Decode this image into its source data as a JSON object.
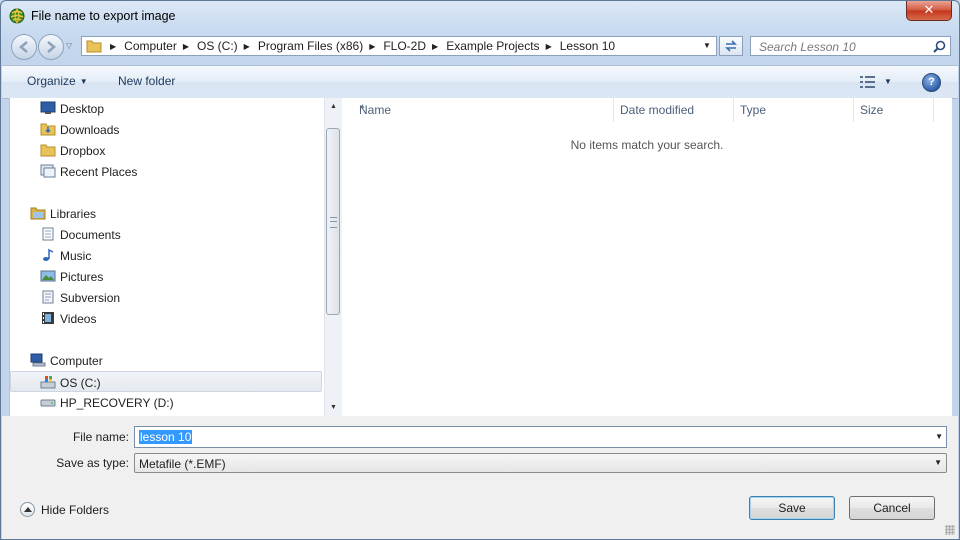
{
  "window": {
    "title": "File name to export image",
    "close_label": "✕"
  },
  "address": {
    "crumbs": [
      "Computer",
      "OS (C:)",
      "Program Files (x86)",
      "FLO-2D",
      "Example Projects",
      "Lesson 10"
    ]
  },
  "search": {
    "placeholder": "Search Lesson 10"
  },
  "toolbar": {
    "organize_label": "Organize",
    "new_folder_label": "New folder",
    "help_label": "?"
  },
  "nav_pane": {
    "items": [
      {
        "label": "Desktop",
        "icon": "desktop-icon"
      },
      {
        "label": "Downloads",
        "icon": "downloads-folder-icon"
      },
      {
        "label": "Dropbox",
        "icon": "dropbox-folder-icon"
      },
      {
        "label": "Recent Places",
        "icon": "recent-places-icon"
      },
      {
        "label": "Libraries",
        "icon": "libraries-icon"
      },
      {
        "label": "Documents",
        "icon": "documents-icon"
      },
      {
        "label": "Music",
        "icon": "music-icon"
      },
      {
        "label": "Pictures",
        "icon": "pictures-icon"
      },
      {
        "label": "Subversion",
        "icon": "subversion-icon"
      },
      {
        "label": "Videos",
        "icon": "videos-icon"
      },
      {
        "label": "Computer",
        "icon": "computer-icon"
      },
      {
        "label": "OS (C:)",
        "icon": "os-drive-icon",
        "selected": true
      },
      {
        "label": "HP_RECOVERY (D:)",
        "icon": "drive-icon"
      }
    ]
  },
  "file_list": {
    "columns": [
      "Name",
      "Date modified",
      "Type",
      "Size"
    ],
    "empty_message": "No items match your search."
  },
  "form": {
    "file_name_label": "File name:",
    "file_name_value": "lesson 10",
    "save_type_label": "Save as type:",
    "save_type_value": "Metafile (*.EMF)"
  },
  "footer": {
    "hide_folders_label": "Hide Folders",
    "save_label": "Save",
    "cancel_label": "Cancel"
  },
  "colors": {
    "selection": "#3399ff",
    "title_gradient_top": "#dbe8f6",
    "close_red": "#c3361c"
  }
}
